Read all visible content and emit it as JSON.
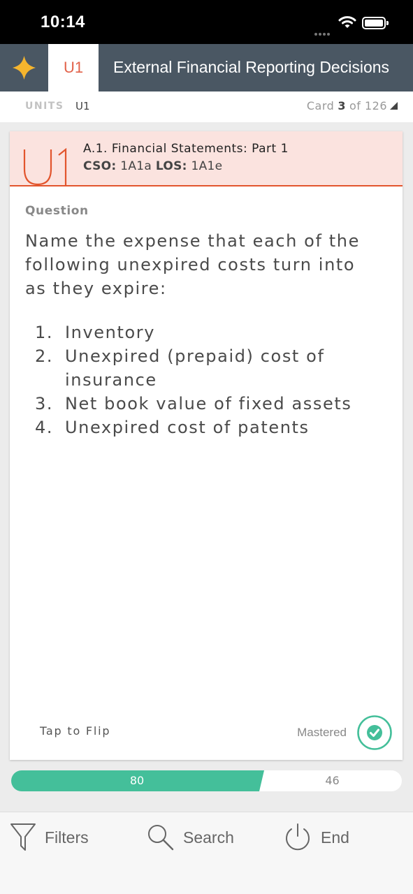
{
  "status_bar": {
    "time": "10:14",
    "icons": [
      "signal-dots-icon",
      "wifi-icon",
      "battery-icon"
    ]
  },
  "header": {
    "plus_icon": "plus-icon",
    "unit_tab": "U1",
    "title": "External Financial Reporting Decisions",
    "colors": {
      "bar": "#4a5763",
      "accent": "#e2624a",
      "plus": "#f5b52e"
    }
  },
  "subbar": {
    "units_label": "UNITS",
    "unit_value": "U1",
    "card_prefix": "Card",
    "card_number": "3",
    "card_of": "of 126"
  },
  "card": {
    "unit_mark": "U1",
    "section_title": "A.1. Financial Statements: Part 1",
    "cso_label": "CSO:",
    "cso_value": "1A1a",
    "los_label": "LOS:",
    "los_value": "1A1e",
    "question_label": "Question",
    "question_text": "Name the expense that each of the following unexpired costs turn into as they expire:",
    "items": [
      {
        "num": "1.",
        "text": "Inventory"
      },
      {
        "num": "2.",
        "text": "Unexpired (prepaid) cost of insurance"
      },
      {
        "num": "3.",
        "text": "Net book value of fixed assets"
      },
      {
        "num": "4.",
        "text": "Unexpired cost of patents"
      }
    ],
    "tap_to_flip": "Tap to Flip",
    "mastered_label": "Mastered",
    "mastered_icon": "check-circle-icon",
    "colors": {
      "head_bg": "#fbe3df",
      "head_border": "#e2552d",
      "mastered": "#44bf9a"
    }
  },
  "progress": {
    "left_value": "80",
    "right_value": "46",
    "fraction_filled": 0.635,
    "color": "#44bf9a"
  },
  "tabbar": {
    "filters": "Filters",
    "search": "Search",
    "end": "End",
    "icons": [
      "filter-icon",
      "search-icon",
      "power-icon"
    ]
  }
}
